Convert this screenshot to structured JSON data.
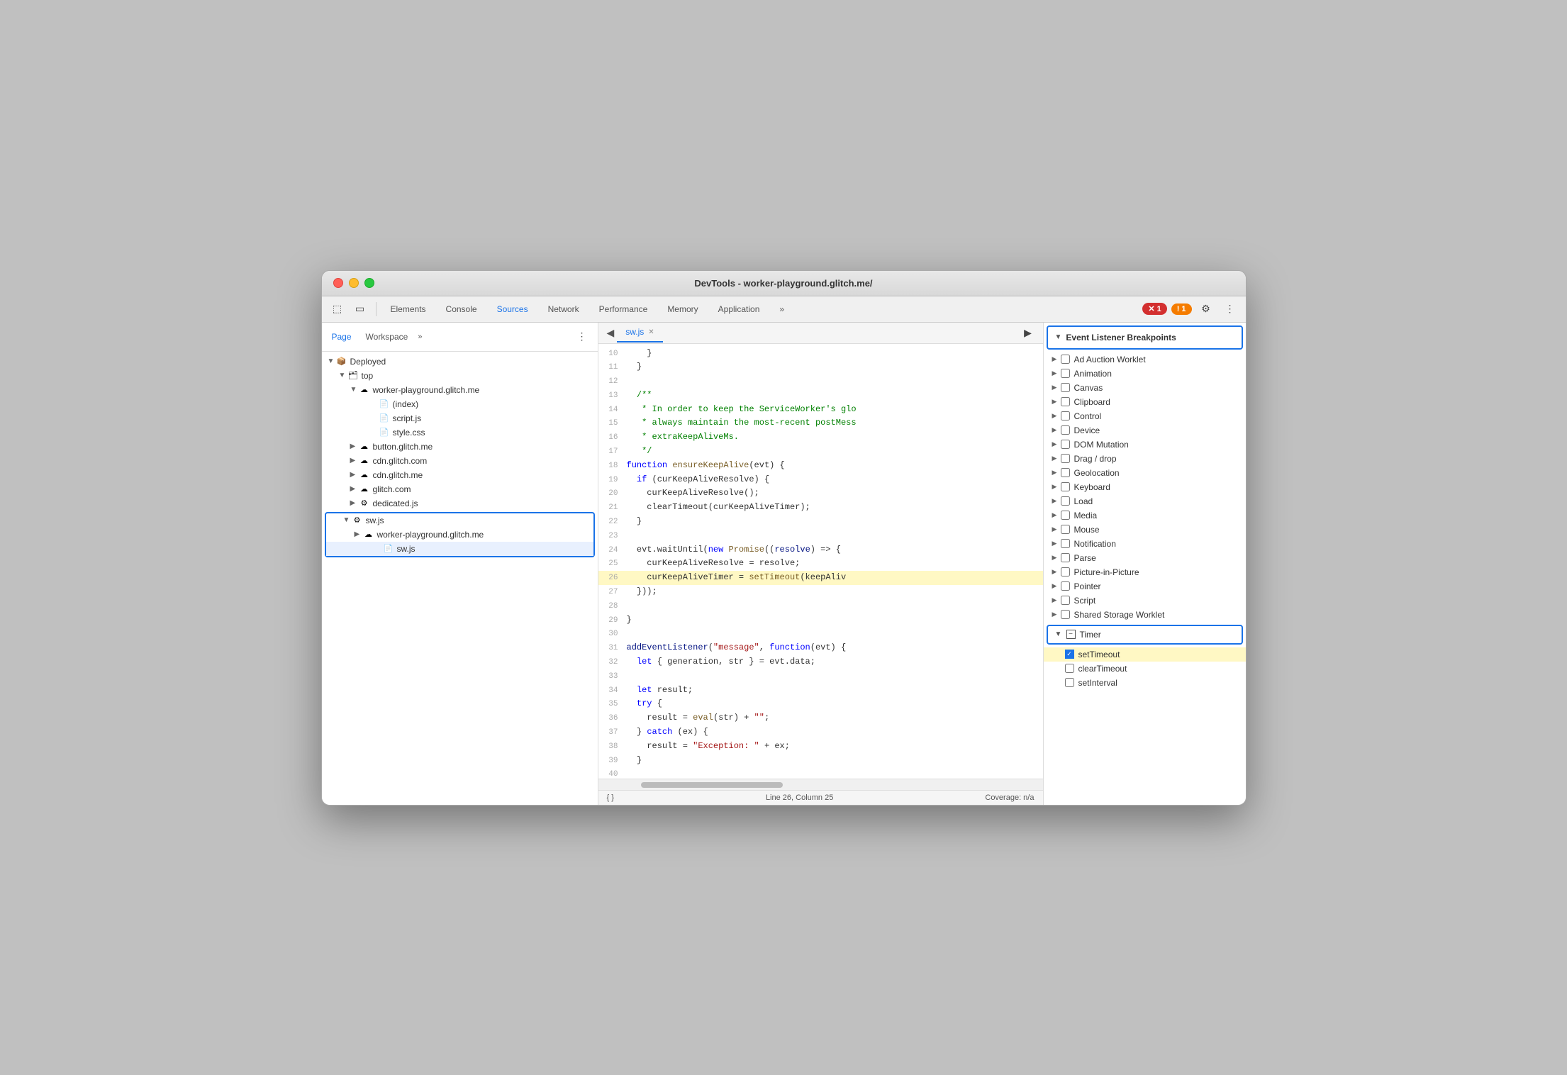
{
  "window": {
    "title": "DevTools - worker-playground.glitch.me/"
  },
  "toolbar": {
    "tabs": [
      {
        "label": "Elements",
        "active": false
      },
      {
        "label": "Console",
        "active": false
      },
      {
        "label": "Sources",
        "active": true
      },
      {
        "label": "Network",
        "active": false
      },
      {
        "label": "Performance",
        "active": false
      },
      {
        "label": "Memory",
        "active": false
      },
      {
        "label": "Application",
        "active": false
      }
    ],
    "more_tabs": "»",
    "error_count": "1",
    "warn_count": "1"
  },
  "left_panel": {
    "tabs": [
      "Page",
      "Workspace"
    ],
    "more": "»",
    "file_tree": [
      {
        "indent": 0,
        "arrow": "▼",
        "icon": "📦",
        "label": "Deployed"
      },
      {
        "indent": 1,
        "arrow": "▼",
        "icon": "🗂",
        "label": "top"
      },
      {
        "indent": 2,
        "arrow": "▼",
        "icon": "☁",
        "label": "worker-playground.glitch.me"
      },
      {
        "indent": 3,
        "arrow": "",
        "icon": "📄",
        "label": "(index)"
      },
      {
        "indent": 3,
        "arrow": "",
        "icon": "🟧",
        "label": "script.js"
      },
      {
        "indent": 3,
        "arrow": "",
        "icon": "🟪",
        "label": "style.css"
      },
      {
        "indent": 2,
        "arrow": "▶",
        "icon": "☁",
        "label": "button.glitch.me"
      },
      {
        "indent": 2,
        "arrow": "▶",
        "icon": "☁",
        "label": "cdn.glitch.com"
      },
      {
        "indent": 2,
        "arrow": "▶",
        "icon": "☁",
        "label": "cdn.glitch.me"
      },
      {
        "indent": 2,
        "arrow": "▶",
        "icon": "☁",
        "label": "glitch.com"
      },
      {
        "indent": 2,
        "arrow": "▶",
        "icon": "⚙",
        "label": "dedicated.js"
      }
    ],
    "highlighted_tree": [
      {
        "indent": 1,
        "arrow": "▼",
        "icon": "⚙",
        "label": "sw.js"
      },
      {
        "indent": 2,
        "arrow": "▶",
        "icon": "☁",
        "label": "worker-playground.glitch.me"
      },
      {
        "indent": 3,
        "arrow": "",
        "icon": "🟧",
        "label": "sw.js"
      }
    ]
  },
  "editor": {
    "tab_label": "sw.js",
    "lines": [
      {
        "num": "10",
        "content": "    }"
      },
      {
        "num": "11",
        "content": "  }"
      },
      {
        "num": "12",
        "content": ""
      },
      {
        "num": "13",
        "content": "  /**"
      },
      {
        "num": "14",
        "content": "   * In order to keep the ServiceWorker's glo"
      },
      {
        "num": "15",
        "content": "   * always maintain the most-recent postMess"
      },
      {
        "num": "16",
        "content": "   * extraKeepAliveMs."
      },
      {
        "num": "17",
        "content": "   */"
      },
      {
        "num": "18",
        "content": "function ensureKeepAlive(evt) {",
        "has_keyword": true
      },
      {
        "num": "19",
        "content": "  if (curKeepAliveResolve) {",
        "has_keyword": true
      },
      {
        "num": "20",
        "content": "    curKeepAliveResolve();"
      },
      {
        "num": "21",
        "content": "    clearTimeout(curKeepAliveTimer);"
      },
      {
        "num": "22",
        "content": "  }"
      },
      {
        "num": "23",
        "content": ""
      },
      {
        "num": "24",
        "content": "  evt.waitUntil(new Promise((resolve) => {",
        "has_keyword": true
      },
      {
        "num": "25",
        "content": "    curKeepAliveResolve = resolve;"
      },
      {
        "num": "26",
        "content": "    curKeepAliveTimer = setTimeout(keepAliv",
        "highlighted": true
      },
      {
        "num": "27",
        "content": "  }));"
      },
      {
        "num": "28",
        "content": ""
      },
      {
        "num": "29",
        "content": "}"
      },
      {
        "num": "30",
        "content": ""
      },
      {
        "num": "31",
        "content": "addEventListener(\"message\", function(evt) {",
        "has_keyword": true
      },
      {
        "num": "32",
        "content": "  let { generation, str } = evt.data;",
        "has_keyword": true
      },
      {
        "num": "33",
        "content": ""
      },
      {
        "num": "34",
        "content": "  let result;",
        "has_keyword": true
      },
      {
        "num": "35",
        "content": "  try {",
        "has_keyword": true
      },
      {
        "num": "36",
        "content": "    result = eval(str) + \"\";",
        "has_keyword": true
      },
      {
        "num": "37",
        "content": "  } catch (ex) {",
        "has_keyword": true
      },
      {
        "num": "38",
        "content": "    result = \"Exception: \" + ex;"
      },
      {
        "num": "39",
        "content": "  }"
      },
      {
        "num": "40",
        "content": ""
      }
    ],
    "footer": {
      "format": "{ }",
      "position": "Line 26, Column 25",
      "coverage": "Coverage: n/a"
    }
  },
  "breakpoints": {
    "header": "Event Listener Breakpoints",
    "items": [
      {
        "label": "Ad Auction Worklet"
      },
      {
        "label": "Animation"
      },
      {
        "label": "Canvas"
      },
      {
        "label": "Clipboard"
      },
      {
        "label": "Control"
      },
      {
        "label": "Device"
      },
      {
        "label": "DOM Mutation"
      },
      {
        "label": "Drag / drop"
      },
      {
        "label": "Geolocation"
      },
      {
        "label": "Keyboard"
      },
      {
        "label": "Load"
      },
      {
        "label": "Media"
      },
      {
        "label": "Mouse"
      },
      {
        "label": "Notification"
      },
      {
        "label": "Parse"
      },
      {
        "label": "Picture-in-Picture"
      },
      {
        "label": "Pointer"
      },
      {
        "label": "Script"
      },
      {
        "label": "Shared Storage Worklet"
      }
    ],
    "timer_group": {
      "label": "Timer",
      "children": [
        {
          "label": "setTimeout",
          "checked": true,
          "highlighted": true
        },
        {
          "label": "clearTimeout",
          "checked": false
        },
        {
          "label": "setInterval",
          "checked": false
        }
      ]
    }
  },
  "icons": {
    "cursor": "⬚",
    "inspect": "◻",
    "close": "✕",
    "gear": "⚙",
    "more": "⋮",
    "resume": "▶",
    "step_over": "↷",
    "step_into": "↓",
    "step_out": "↑",
    "deactivate": "⊘",
    "pretty_print": "{ }",
    "panel_collapse": "◀"
  }
}
